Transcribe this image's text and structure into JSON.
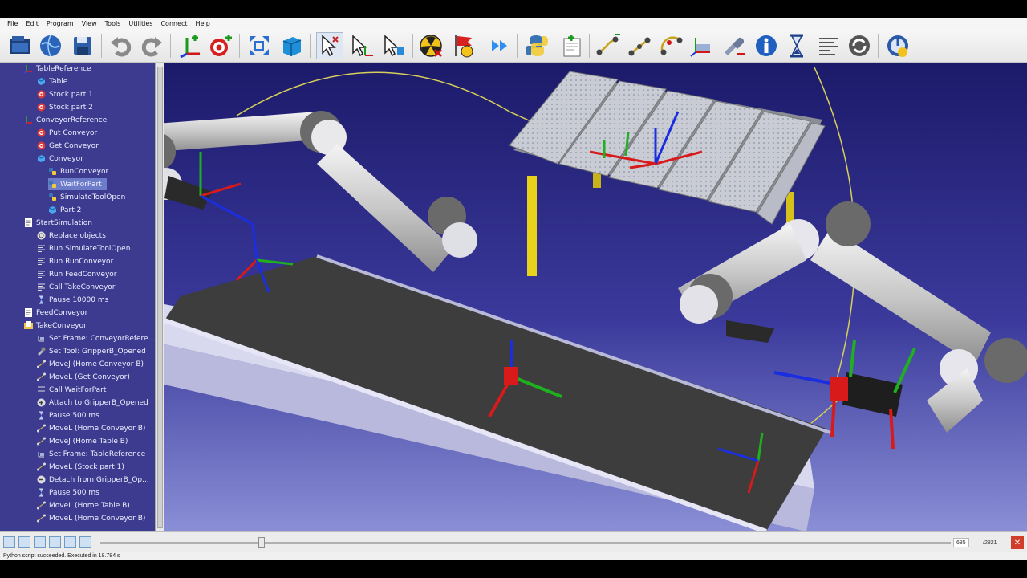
{
  "menu": [
    "File",
    "Edit",
    "Program",
    "View",
    "Tools",
    "Utilities",
    "Connect",
    "Help"
  ],
  "toolbar": {
    "icons": [
      "open-station-icon",
      "online-library-icon",
      "save-icon",
      "undo-icon",
      "redo-icon",
      "add-reference-frame-icon",
      "add-target-icon",
      "fit-all-icon",
      "isometric-view-icon",
      "select-icon",
      "move-reference-icon",
      "move-object-icon",
      "check-collisions-icon",
      "collision-map-icon",
      "fast-simulation-icon",
      "python-program-icon",
      "add-program-icon",
      "move-joint-icon",
      "move-linear-icon",
      "move-circular-icon",
      "set-reference-frame-icon",
      "set-tool-frame-icon",
      "info-icon",
      "pause-icon",
      "program-call-icon",
      "rotate-icon",
      "connect-robot-icon"
    ]
  },
  "tree": {
    "items": [
      {
        "label": "TableReference",
        "icon": "frame-icon",
        "indent": 1
      },
      {
        "label": "Table",
        "icon": "object-icon",
        "indent": 2
      },
      {
        "label": "Stock part 1",
        "icon": "target-icon",
        "indent": 2
      },
      {
        "label": "Stock part 2",
        "icon": "target-icon",
        "indent": 2
      },
      {
        "label": "ConveyorReference",
        "icon": "frame-icon",
        "indent": 1
      },
      {
        "label": "Put Conveyor",
        "icon": "target-icon",
        "indent": 2
      },
      {
        "label": "Get Conveyor",
        "icon": "target-icon",
        "indent": 2
      },
      {
        "label": "Conveyor",
        "icon": "object-icon",
        "indent": 2
      },
      {
        "label": "RunConveyor",
        "icon": "python-icon",
        "indent": 3
      },
      {
        "label": "WaitForPart",
        "icon": "python-icon",
        "indent": 3,
        "selected": true
      },
      {
        "label": "SimulateToolOpen",
        "icon": "python-icon",
        "indent": 3
      },
      {
        "label": "Part 2",
        "icon": "object-icon",
        "indent": 3
      },
      {
        "label": "StartSimulation",
        "icon": "program-icon",
        "indent": 1
      },
      {
        "label": "Replace objects",
        "icon": "replace-icon",
        "indent": 2
      },
      {
        "label": "Run SimulateToolOpen",
        "icon": "program-call-icon",
        "indent": 2
      },
      {
        "label": "Run RunConveyor",
        "icon": "program-call-icon",
        "indent": 2
      },
      {
        "label": "Run FeedConveyor",
        "icon": "program-call-icon",
        "indent": 2
      },
      {
        "label": "Call TakeConveyor",
        "icon": "program-call-icon",
        "indent": 2
      },
      {
        "label": "Pause 10000 ms",
        "icon": "pause-icon",
        "indent": 2
      },
      {
        "label": "FeedConveyor",
        "icon": "program-icon",
        "indent": 1
      },
      {
        "label": "TakeConveyor",
        "icon": "program-folder-icon",
        "indent": 1
      },
      {
        "label": "Set Frame: ConveyorRefere...",
        "icon": "set-frame-icon",
        "indent": 2
      },
      {
        "label": "Set Tool: GripperB_Opened",
        "icon": "set-tool-icon",
        "indent": 2
      },
      {
        "label": "MoveJ (Home Conveyor B)",
        "icon": "move-joint-icon",
        "indent": 2
      },
      {
        "label": "MoveL (Get Conveyor)",
        "icon": "move-linear-icon",
        "indent": 2
      },
      {
        "label": "Call WaitForPart",
        "icon": "program-call-icon",
        "indent": 2
      },
      {
        "label": "Attach to GripperB_Opened",
        "icon": "attach-icon",
        "indent": 2
      },
      {
        "label": "Pause 500 ms",
        "icon": "pause-icon",
        "indent": 2
      },
      {
        "label": "MoveL (Home Conveyor B)",
        "icon": "move-linear-icon",
        "indent": 2
      },
      {
        "label": "MoveJ (Home Table B)",
        "icon": "move-joint-icon",
        "indent": 2
      },
      {
        "label": "Set Frame: TableReference",
        "icon": "set-frame-icon",
        "indent": 2
      },
      {
        "label": "MoveL (Stock part 1)",
        "icon": "move-linear-icon",
        "indent": 2
      },
      {
        "label": "Detach from GripperB_Op...",
        "icon": "detach-icon",
        "indent": 2
      },
      {
        "label": "Pause 500 ms",
        "icon": "pause-icon",
        "indent": 2
      },
      {
        "label": "MoveL (Home Table B)",
        "icon": "move-linear-icon",
        "indent": 2
      },
      {
        "label": "MoveL (Home Conveyor B)",
        "icon": "move-linear-icon",
        "indent": 2
      }
    ]
  },
  "timeline": {
    "buttons": [
      "first-frame-icon",
      "previous-frame-icon",
      "play-icon",
      "next-frame-icon",
      "last-frame-icon",
      "loop-icon"
    ],
    "current_frame": "685",
    "total_frames": "/2821",
    "progress": 0.19
  },
  "status": "Python script succeeded. Executed in 18.784 s"
}
